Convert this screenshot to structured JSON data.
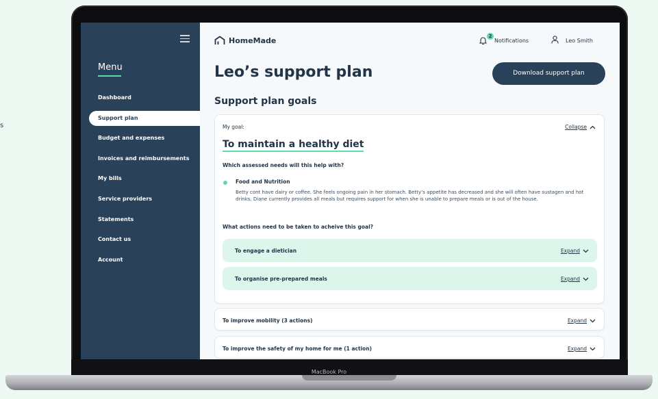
{
  "stray_text": "s",
  "laptop_label": "MacBook Pro",
  "sidebar": {
    "menu_title": "Menu",
    "items": [
      {
        "label": "Dashboard"
      },
      {
        "label": "Support plan"
      },
      {
        "label": "Budget and expenses"
      },
      {
        "label": "Invoices and reimbursements"
      },
      {
        "label": "My bills"
      },
      {
        "label": "Service providers"
      },
      {
        "label": "Statements"
      },
      {
        "label": "Contact us"
      },
      {
        "label": "Account"
      }
    ],
    "active_item": "Support plan"
  },
  "header": {
    "brand": "HomeMade",
    "notifications_label": "Notifications",
    "notifications_count": "2",
    "user_name": "Leo Smith"
  },
  "page": {
    "title": "Leo’s support plan",
    "download_button": "Download support plan",
    "section_title": "Support plan goals"
  },
  "goal": {
    "label": "My goal:",
    "collapse_label": "Collapse",
    "title": "To maintain a healthy diet",
    "needs_question": "Which assessed needs will this help with?",
    "need_title": "Food and Nutrition",
    "need_description": "Betty cont have dairy or coffee. She feels ongoing pain in her stomach. Betty’s appetite has decreased and she will often have sustagen and hot drinks. Diane currently provides all meals but requires support for when she is unable to prepare meals or is out of the house.",
    "actions_question": "What actions need to be taken to acheive this goal?",
    "actions": [
      {
        "label": "To engage a dietician",
        "toggle": "Expand"
      },
      {
        "label": "To organise pre-prepared meals",
        "toggle": "Expand"
      }
    ]
  },
  "other_goals": [
    {
      "label": "To improve mobility (3 actions)",
      "toggle": "Expand"
    },
    {
      "label": "To improve the safety of my home for me (1 action)",
      "toggle": "Expand"
    }
  ],
  "colors": {
    "sidebar_bg": "#2a4259",
    "accent": "#5fd9a9",
    "action_bg": "#ddf6ec",
    "page_bg": "#eef9f4"
  }
}
